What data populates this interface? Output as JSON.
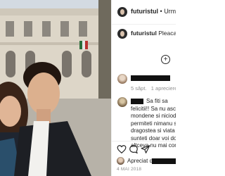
{
  "post": {
    "username": "futuristul",
    "follow_separator": "•",
    "follow_label": "Urmărește",
    "caption_username": "futuristul",
    "caption_text": "Pleaca la Sc",
    "add_icon": "plus-circle-icon"
  },
  "comments": [
    {
      "avatar_icon": "user-avatar",
      "time": "5 săpt.",
      "reply_label": "1 apreciere",
      "redacted": true
    },
    {
      "avatar_icon": "user-avatar",
      "lines": [
        "Sa fiti sa",
        "felicitii!! Sa nu ascult",
        "mondene si niciodata",
        "permiteti nimanu sa i",
        "dragostea si viata voa",
        "sunteti doar voi doi si",
        "altceva nu mai contea"
      ],
      "redacted": true
    }
  ],
  "actions": {
    "like_icon": "heart-icon",
    "comment_icon": "comment-icon",
    "share_icon": "share-icon",
    "likes_prefix": "Apreciat de",
    "date": "4 MAI 2018"
  },
  "colors": {
    "text": "#262626",
    "muted": "#8e8e8e",
    "divider": "#efefef"
  }
}
